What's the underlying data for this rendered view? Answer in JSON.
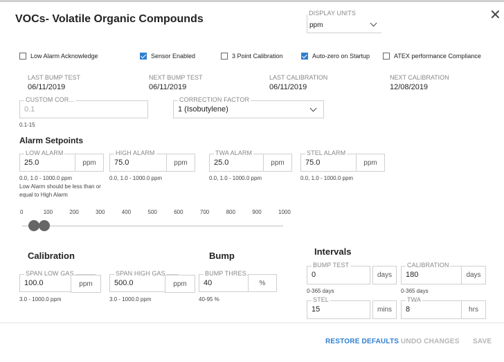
{
  "dialog": {
    "title": "VOCs- Volatile Organic Compounds"
  },
  "display_units": {
    "label": "DISPLAY UNITS",
    "value": "ppm"
  },
  "checkboxes": [
    {
      "label": "Low Alarm Acknowledge",
      "checked": false
    },
    {
      "label": "Sensor Enabled",
      "checked": true
    },
    {
      "label": "3 Point Calibration",
      "checked": false
    },
    {
      "label": "Auto-zero on Startup",
      "checked": true
    },
    {
      "label": "ATEX performance Compliance",
      "checked": false
    }
  ],
  "dates": [
    {
      "label": "LAST BUMP TEST",
      "value": "06/11/2019"
    },
    {
      "label": "NEXT BUMP TEST",
      "value": "06/11/2019"
    },
    {
      "label": "LAST CALIBRATION",
      "value": "06/11/2019"
    },
    {
      "label": "NEXT CALIBRATION",
      "value": "12/08/2019"
    }
  ],
  "custom_cor": {
    "label": "CUSTOM COR...",
    "value": "0.1",
    "hint": "0.1-15"
  },
  "correction_factor": {
    "label": "CORRECTION FACTOR",
    "value": "1 (Isobutylene)"
  },
  "alarm_setpoints": {
    "title": "Alarm Setpoints",
    "low": {
      "label": "LOW ALARM",
      "value": "25.0",
      "unit": "ppm",
      "hint": "0.0, 1.0 - 1000.0 ppm",
      "note": "Low Alarm should be less than or equal to High Alarm"
    },
    "high": {
      "label": "HIGH ALARM",
      "value": "75.0",
      "unit": "ppm",
      "hint": "0.0, 1.0 - 1000.0 ppm"
    },
    "twa": {
      "label": "TWA ALARM",
      "value": "25.0",
      "unit": "ppm",
      "hint": "0.0, 1.0 - 1000.0 ppm"
    },
    "stel": {
      "label": "STEL ALARM",
      "value": "75.0",
      "unit": "ppm",
      "hint": "0.0, 1.0 - 1000.0 ppm"
    }
  },
  "slider": {
    "ticks": [
      "0",
      "100",
      "200",
      "300",
      "400",
      "500",
      "600",
      "700",
      "800",
      "900",
      "1000"
    ],
    "min": 0,
    "max": 1000,
    "low_value": 25,
    "high_value": 75
  },
  "calibration": {
    "title": "Calibration",
    "span_low": {
      "label": "SPAN LOW GAS",
      "value": "100.0",
      "unit": "ppm",
      "hint": "3.0 - 1000.0 ppm"
    },
    "span_high": {
      "label": "SPAN HIGH GAS",
      "value": "500.0",
      "unit": "ppm",
      "hint": "3.0 - 1000.0 ppm"
    }
  },
  "bump": {
    "title": "Bump",
    "threshold": {
      "label": "BUMP THRES...",
      "value": "40",
      "unit": "%",
      "hint": "40-95 %"
    }
  },
  "intervals": {
    "title": "Intervals",
    "bump_test": {
      "label": "BUMP TEST",
      "value": "0",
      "unit": "days",
      "hint": "0-365 days"
    },
    "calibration": {
      "label": "CALIBRATION",
      "value": "180",
      "unit": "days",
      "hint": "0-365 days"
    },
    "stel": {
      "label": "STEL",
      "value": "15",
      "unit": "mins"
    },
    "twa": {
      "label": "TWA",
      "value": "8",
      "unit": "hrs"
    }
  },
  "footer": {
    "restore": "RESTORE DEFAULTS",
    "undo": "UNDO CHANGES",
    "save": "SAVE"
  },
  "colors": {
    "accent": "#2f7fd1",
    "disabled": "#b5b5b5",
    "border": "#cfcfcf"
  }
}
